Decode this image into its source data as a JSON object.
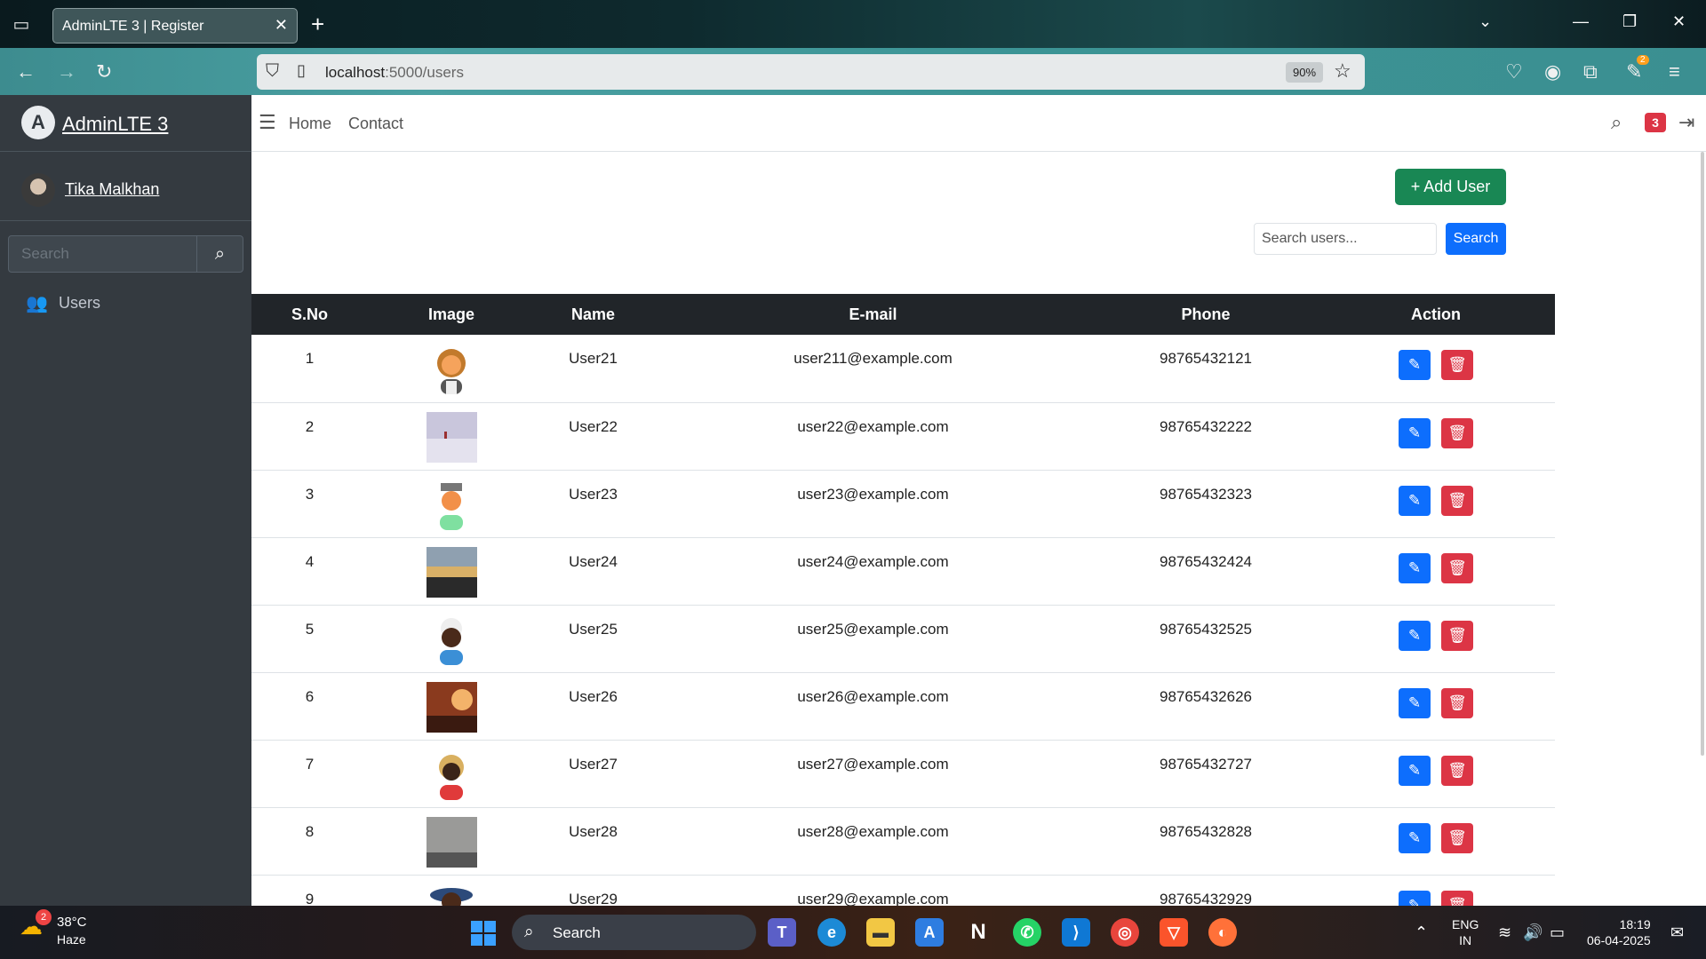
{
  "browser": {
    "tab_title": "AdminLTE 3 | Register",
    "url_host": "localhost",
    "url_path": ":5000/users",
    "zoom": "90%"
  },
  "sidebar": {
    "brand": "AdminLTE 3",
    "brand_logo": "A",
    "user_name": "Tika Malkhan",
    "search_placeholder": "Search",
    "items": [
      {
        "label": "Users",
        "icon": "users-icon"
      }
    ]
  },
  "header": {
    "nav": [
      "Home",
      "Contact"
    ],
    "notification_count": "3"
  },
  "content": {
    "add_user_label": "+ Add User",
    "search_placeholder": "Search users...",
    "search_button": "Search",
    "table": {
      "headers": [
        "S.No",
        "Image",
        "Name",
        "E-mail",
        "Phone",
        "Action"
      ],
      "rows": [
        {
          "sno": "1",
          "name": "User21",
          "email": "user211@example.com",
          "phone": "98765432121",
          "image": "avatar-woman"
        },
        {
          "sno": "2",
          "name": "User22",
          "email": "user22@example.com",
          "phone": "98765432222",
          "image": "photo-snow"
        },
        {
          "sno": "3",
          "name": "User23",
          "email": "user23@example.com",
          "phone": "98765432323",
          "image": "avatar-man-cap"
        },
        {
          "sno": "4",
          "name": "User24",
          "email": "user24@example.com",
          "phone": "98765432424",
          "image": "photo-sunset-jump"
        },
        {
          "sno": "5",
          "name": "User25",
          "email": "user25@example.com",
          "phone": "98765432525",
          "image": "avatar-man-turban"
        },
        {
          "sno": "6",
          "name": "User26",
          "email": "user26@example.com",
          "phone": "98765432626",
          "image": "photo-couple-sunset"
        },
        {
          "sno": "7",
          "name": "User27",
          "email": "user27@example.com",
          "phone": "98765432727",
          "image": "avatar-woman-blonde"
        },
        {
          "sno": "8",
          "name": "User28",
          "email": "user28@example.com",
          "phone": "98765432828",
          "image": "photo-city-fog"
        },
        {
          "sno": "9",
          "name": "User29",
          "email": "user29@example.com",
          "phone": "98765432929",
          "image": "avatar-man-hat"
        }
      ]
    }
  },
  "taskbar": {
    "weather_temp": "38°C",
    "weather_desc": "Haze",
    "weather_badge": "2",
    "search_label": "Search",
    "lang_1": "ENG",
    "lang_2": "IN",
    "time": "18:19",
    "date": "06-04-2025"
  },
  "colors": {
    "sidebar_bg": "#343a40",
    "primary": "#0d6efd",
    "success": "#198754",
    "danger": "#dc3545",
    "table_head": "#212529"
  }
}
